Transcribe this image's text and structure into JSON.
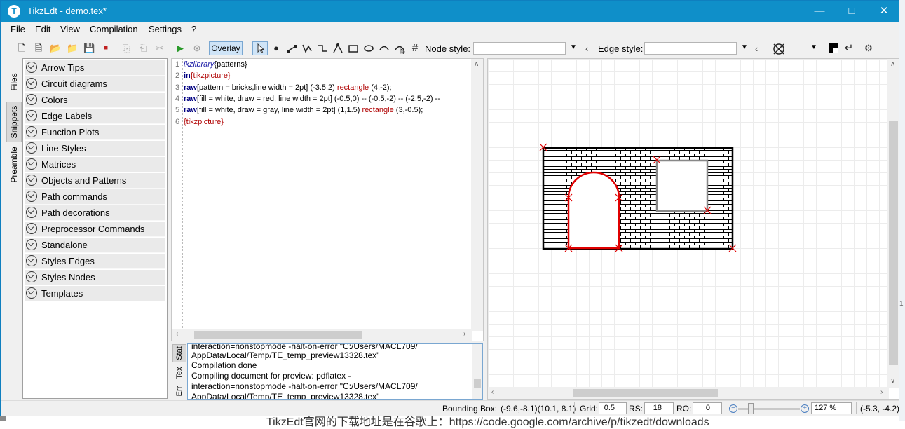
{
  "window": {
    "title": "TikzEdt - demo.tex*",
    "app_icon": "T"
  },
  "menu": [
    "File",
    "Edit",
    "View",
    "Compilation",
    "Settings",
    "?"
  ],
  "toolbar": {
    "overlay_label": "Overlay",
    "node_style_label": "Node style:",
    "edge_style_label": "Edge style:"
  },
  "dock_tabs": [
    "Files",
    "Snippets",
    "Preamble"
  ],
  "snippets": [
    "Arrow Tips",
    "Circuit diagrams",
    "Colors",
    "Edge Labels",
    "Function Plots",
    "Line Styles",
    "Matrices",
    "Objects and Patterns",
    "Path commands",
    "Path decorations",
    "Preprocessor Commands",
    "Standalone",
    "Styles Edges",
    "Styles Nodes",
    "Templates"
  ],
  "editor": {
    "line_numbers": [
      "1",
      "2",
      "3",
      "4",
      "5",
      "6"
    ],
    "lines": [
      [
        {
          "t": "ikzlibrary",
          "c": "it"
        },
        {
          "t": "{patterns}",
          "c": ""
        }
      ],
      [
        {
          "t": "in",
          "c": "kw"
        },
        {
          "t": "{tikzpicture}",
          "c": "rd"
        }
      ],
      [
        {
          "t": "raw",
          "c": "kw"
        },
        {
          "t": "[pattern = bricks,line width = 2pt]  (-3.5,2) ",
          "c": ""
        },
        {
          "t": "rectangle",
          "c": "rd"
        },
        {
          "t": " (4,-2);",
          "c": ""
        }
      ],
      [
        {
          "t": "raw",
          "c": "kw"
        },
        {
          "t": "[fill = white, draw = red, line width = 2pt] (-0.5,0) -- (-0.5,-2) -- (-2.5,-2) --",
          "c": ""
        }
      ],
      [
        {
          "t": "raw",
          "c": "kw"
        },
        {
          "t": "[fill = white, draw = gray, line width = 2pt] (1,1.5) ",
          "c": ""
        },
        {
          "t": "rectangle",
          "c": "rd"
        },
        {
          "t": " (3,-0.5);",
          "c": ""
        }
      ],
      [
        {
          "t": "{tikzpicture}",
          "c": "rd"
        }
      ]
    ]
  },
  "log": {
    "tabs": [
      "Stat",
      "Tex",
      "Err"
    ],
    "lines": [
      "interaction=nonstopmode -halt-on-error \"C:/Users/MACL709/",
      "AppData/Local/Temp/TE_temp_preview13328.tex\"",
      "Compilation done",
      "Compiling document for preview: pdflatex -",
      "interaction=nonstopmode -halt-on-error \"C:/Users/MACL709/",
      "AppData/Local/Temp/TE_temp_preview13328.tex\""
    ]
  },
  "status": {
    "bounding_box_label": "Bounding Box:",
    "bounding_box_value": "(-9.6,-8.1)(10.1, 8.1)",
    "grid_label": "Grid:",
    "grid_value": "0.5",
    "rs_label": "RS:",
    "rs_value": "18",
    "ro_label": "RO:",
    "ro_value": "0",
    "zoom_value": "127 %",
    "cursor_coords": "(-5.3, -4.2)"
  },
  "background_text": "TikzEdt官网的下载地址是在谷歌上：https://code.google.com/archive/p/tikzedt/downloads",
  "colors": {
    "titlebar": "#0f8fc9",
    "accent": "#cfe4f7",
    "pattern_outline": "#000000",
    "arch": "#e00000",
    "window_box": "#888888"
  }
}
